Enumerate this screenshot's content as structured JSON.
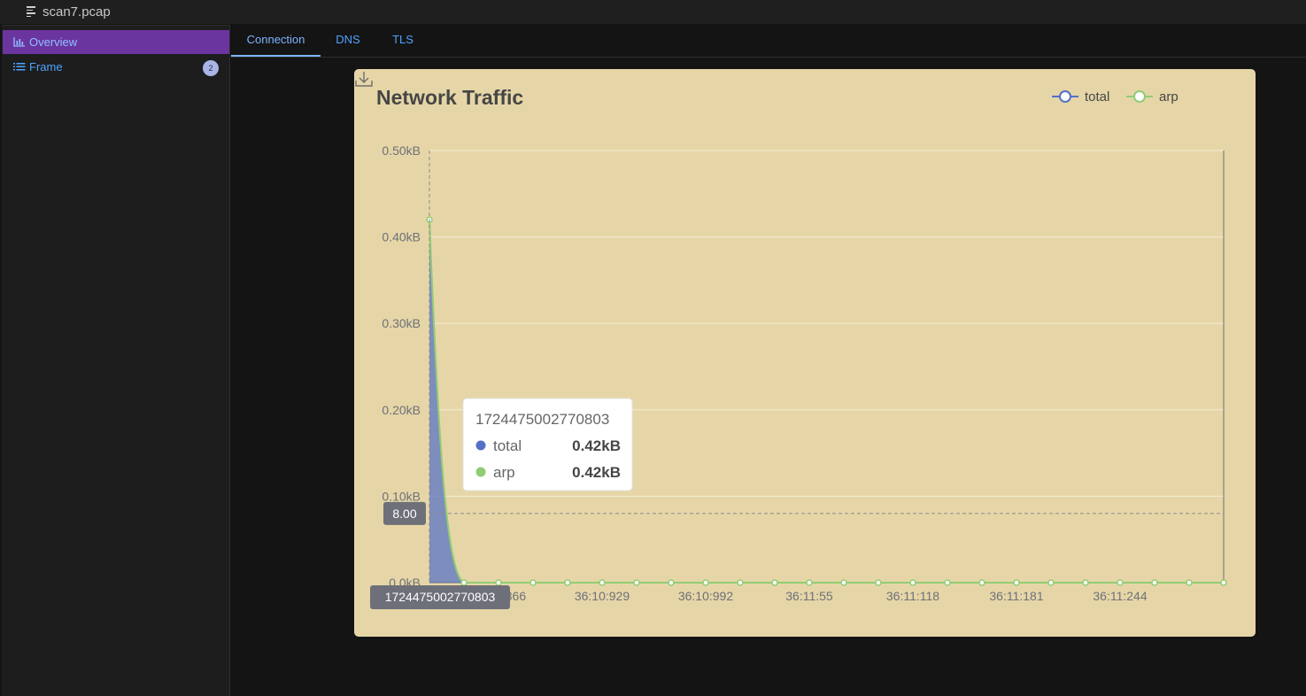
{
  "file": {
    "name": "scan7.pcap",
    "icon": "document-lines-icon"
  },
  "sidebar": {
    "items": [
      {
        "label": "Overview",
        "icon": "bar-chart-icon",
        "active": true
      },
      {
        "label": "Frame",
        "icon": "list-icon",
        "badge": "2"
      }
    ]
  },
  "tabs": [
    {
      "label": "Connection",
      "active": true
    },
    {
      "label": "DNS"
    },
    {
      "label": "TLS"
    }
  ],
  "chart_data": {
    "type": "area",
    "title": "Network Traffic",
    "legend": {
      "placement": "top-right",
      "items": [
        "total",
        "arp"
      ]
    },
    "colors": {
      "total": "#5470c6",
      "arp": "#91cc75"
    },
    "y_unit": "kB",
    "ylim": [
      0,
      0.5
    ],
    "y_ticks": [
      "0.0kB",
      "0.10kB",
      "0.20kB",
      "0.30kB",
      "0.40kB",
      "0.50kB"
    ],
    "x_tick_labels": [
      "36:10:866",
      "36:10:929",
      "36:10:992",
      "36:11:55",
      "36:11:118",
      "36:11:181",
      "36:11:244"
    ],
    "x_point_count": 24,
    "series": [
      {
        "name": "total",
        "values": [
          0.42,
          0,
          0,
          0,
          0,
          0,
          0,
          0,
          0,
          0,
          0,
          0,
          0,
          0,
          0,
          0,
          0,
          0,
          0,
          0,
          0,
          0,
          0,
          0
        ]
      },
      {
        "name": "arp",
        "values": [
          0.42,
          0,
          0,
          0,
          0,
          0,
          0,
          0,
          0,
          0,
          0,
          0,
          0,
          0,
          0,
          0,
          0,
          0,
          0,
          0,
          0,
          0,
          0,
          0
        ]
      }
    ],
    "tooltip": {
      "title": "1724475002770803",
      "rows": [
        {
          "name": "total",
          "value": "0.42kB"
        },
        {
          "name": "arp",
          "value": "0.42kB"
        }
      ]
    },
    "axis_pointer": {
      "x_label": "1724475002770803",
      "y_label": "8.00",
      "y_value": 0.08
    },
    "grid": true,
    "download_icon": "download-icon"
  }
}
